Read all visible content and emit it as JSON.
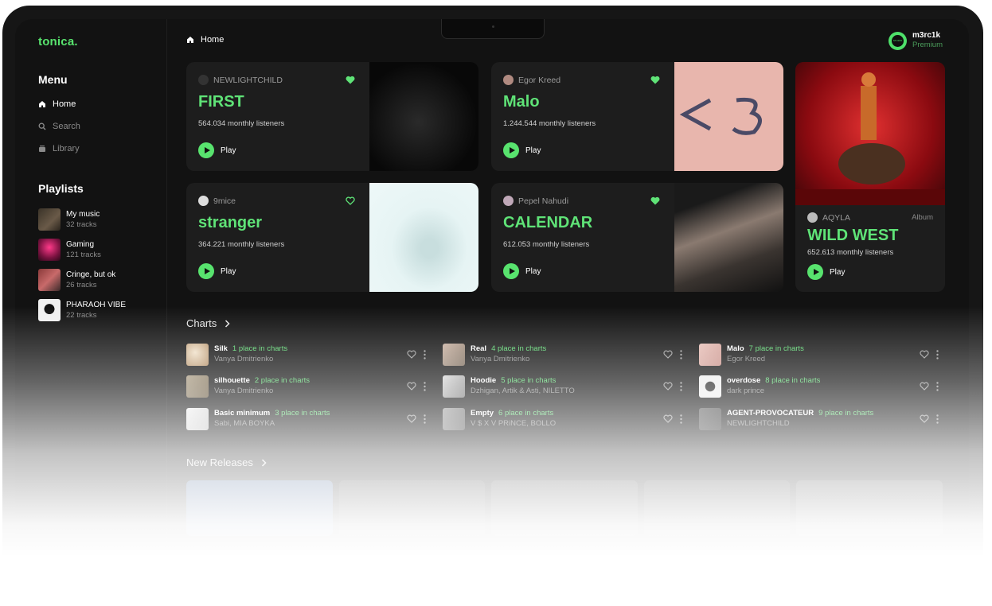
{
  "app": {
    "logo": "tonica."
  },
  "sidebar": {
    "menu_title": "Menu",
    "nav": [
      {
        "label": "Home",
        "icon": "home-icon",
        "active": true
      },
      {
        "label": "Search",
        "icon": "search-icon",
        "active": false
      },
      {
        "label": "Library",
        "icon": "library-icon",
        "active": false
      }
    ],
    "playlists_title": "Playlists",
    "playlists": [
      {
        "name": "My music",
        "count": "32 tracks"
      },
      {
        "name": "Gaming",
        "count": "121 tracks"
      },
      {
        "name": "Cringe, but ok",
        "count": "26 tracks"
      },
      {
        "name": "PHARAOH VIBE",
        "count": "22 tracks"
      }
    ]
  },
  "header": {
    "breadcrumb": "Home"
  },
  "user": {
    "name": "m3rc1k",
    "plan": "Premium"
  },
  "cards": [
    {
      "artist": "NEWLIGHTCHILD",
      "title": "FIRST",
      "listeners": "564.034 monthly listeners",
      "play": "Play",
      "liked": true
    },
    {
      "artist": "Egor Kreed",
      "title": "Malo",
      "listeners": "1.244.544 monthly listeners",
      "play": "Play",
      "liked": true
    },
    {
      "artist": "9mice",
      "title": "stranger",
      "listeners": "364.221 monthly listeners",
      "play": "Play",
      "liked": false
    },
    {
      "artist": "Pepel Nahudi",
      "title": "CALENDAR",
      "listeners": "612.053 monthly listeners",
      "play": "Play",
      "liked": true
    }
  ],
  "featured": {
    "artist": "AQYLA",
    "tag": "Album",
    "title": "WILD WEST",
    "listeners": "652.613 monthly listeners",
    "play": "Play"
  },
  "charts": {
    "title": "Charts",
    "items": [
      {
        "song": "Silk",
        "place": "1 place in charts",
        "artist": "Vanya Dmitrienko"
      },
      {
        "song": "Real",
        "place": "4 place in charts",
        "artist": "Vanya Dmitrienko"
      },
      {
        "song": "Malo",
        "place": "7 place in charts",
        "artist": "Egor Kreed"
      },
      {
        "song": "silhouette",
        "place": "2 place in charts",
        "artist": "Vanya Dmitrienko"
      },
      {
        "song": "Hoodie",
        "place": "5 place in charts",
        "artist": "Dzhigan, Artik & Asti, NILETTO"
      },
      {
        "song": "overdose",
        "place": "8 place in charts",
        "artist": "dark prince"
      },
      {
        "song": "Basic minimum",
        "place": "3 place in charts",
        "artist": "Sabi, MIA BOYKA"
      },
      {
        "song": "Empty",
        "place": "6 place in charts",
        "artist": "V $ X V PRiNCE, BOLLO"
      },
      {
        "song": "AGENT-PROVOCATEUR",
        "place": "9 place in charts",
        "artist": "NEWLIGHTCHILD"
      }
    ]
  },
  "new_releases": {
    "title": "New Releases"
  },
  "colors": {
    "accent": "#58e36e",
    "background": "#121212",
    "card": "#1d1d1d"
  }
}
